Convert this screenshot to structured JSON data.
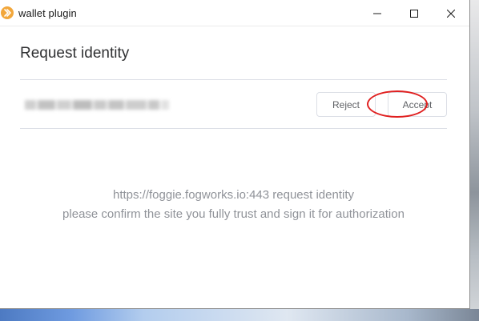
{
  "window": {
    "title": "wallet plugin",
    "app_icon": "chevron-right-circle-icon",
    "controls": {
      "minimize_icon": "minimize-icon",
      "maximize_icon": "maximize-icon",
      "close_icon": "close-icon"
    }
  },
  "dialog": {
    "heading": "Request identity",
    "identity_value_redacted": true,
    "buttons": {
      "reject_label": "Reject",
      "accept_label": "Accept"
    },
    "message": {
      "line1": "https://foggie.fogworks.io:443 request identity",
      "line2": "please confirm the site you fully trust and sign it for authorization"
    }
  },
  "colors": {
    "accent_app_icon": "#f2a73b",
    "highlight_annotation": "#e02020",
    "message_text": "#909399",
    "heading_text": "#303133"
  }
}
